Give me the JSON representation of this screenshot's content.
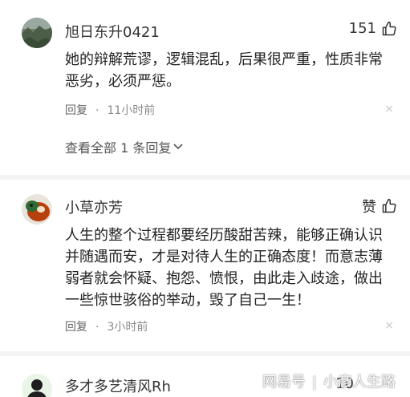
{
  "comments": [
    {
      "username": "旭日东升0421",
      "likes": "151",
      "text": "她的辩解荒谬，逻辑混乱，后果很严重，性质非常恶劣，必须严惩。",
      "reply_label": "回复",
      "separator": "·",
      "time": "11小时前",
      "view_all": "查看全部 1 条回复"
    },
    {
      "username": "小草亦芳",
      "likes": "赞",
      "text": "人生的整个过程都要经历酸甜苦辣，能够正确认识并随遇而安，才是对待人生的正确态度！而意志薄弱者就会怀疑、抱怨、愤恨，由此走入歧途，做出一些惊世骇俗的举动，毁了自己一生！",
      "reply_label": "回复",
      "separator": "·",
      "time": "3小时前"
    },
    {
      "username": "多才多艺清风Rh",
      "likes": "10"
    }
  ],
  "close_glyph": "×",
  "watermark": {
    "brand": "网易号",
    "separator": "|",
    "account": "小彦人生路"
  },
  "colors": {
    "text": "#222222",
    "meta": "#8a8a8a",
    "divider": "#f4f4f4"
  }
}
